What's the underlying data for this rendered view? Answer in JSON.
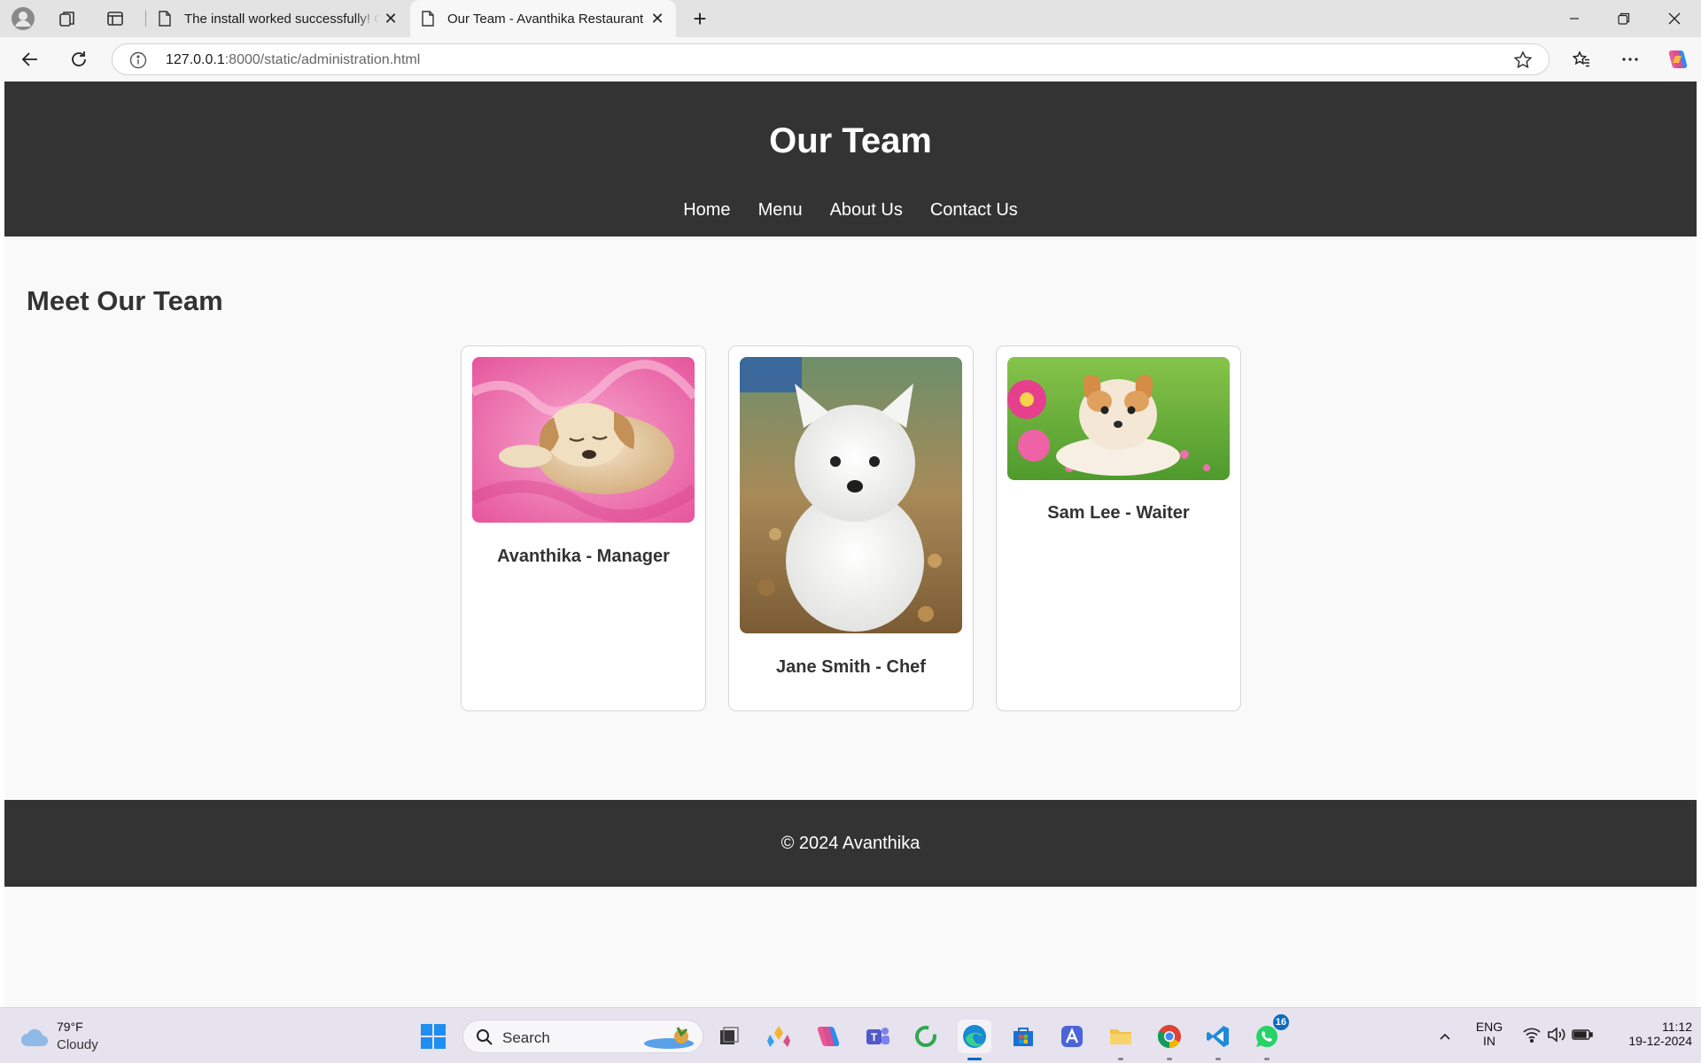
{
  "browser": {
    "tabs": [
      {
        "title": "The install worked successfully! Congratulations!",
        "active": false
      },
      {
        "title": "Our Team - Avanthika Restaurant",
        "active": true
      }
    ],
    "url_host": "127.0.0.1",
    "url_rest": ":8000/static/administration.html"
  },
  "page": {
    "header_title": "Our Team",
    "nav": [
      "Home",
      "Menu",
      "About Us",
      "Contact Us"
    ],
    "section_title": "Meet Our Team",
    "team": [
      {
        "caption": "Avanthika - Manager"
      },
      {
        "caption": "Jane Smith - Chef"
      },
      {
        "caption": "Sam Lee - Waiter"
      }
    ],
    "footer": "© 2024 Avanthika"
  },
  "taskbar": {
    "weather_temp": "79°F",
    "weather_cond": "Cloudy",
    "search_label": "Search",
    "lang_top": "ENG",
    "lang_bottom": "IN",
    "time": "11:12",
    "date": "19-12-2024",
    "whatsapp_badge": "16"
  },
  "colors": {
    "header_bg": "#333333",
    "footer_bg": "#333333",
    "page_bg": "#f9f9f9"
  }
}
